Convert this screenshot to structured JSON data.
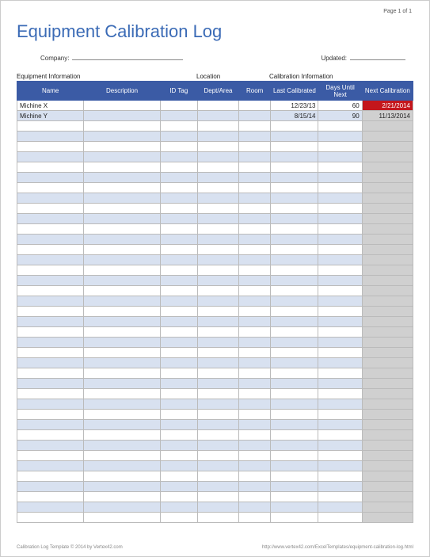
{
  "page_num": "Page 1 of 1",
  "title": "Equipment Calibration Log",
  "meta": {
    "company_label": "Company:",
    "company_value": "",
    "updated_label": "Updated:",
    "updated_value": ""
  },
  "sections": {
    "equipment": "Equipment Information",
    "location": "Location",
    "calibration": "Calibration Information"
  },
  "chart_data": {
    "type": "table",
    "headers": [
      "Name",
      "Description",
      "ID Tag",
      "Dept/Area",
      "Room",
      "Last Calibrated",
      "Days Until Next",
      "Next Calibration"
    ],
    "rows": [
      {
        "name": "Michine X",
        "description": "",
        "id_tag": "",
        "dept": "",
        "room": "",
        "last": "12/23/13",
        "days": "60",
        "next": "2/21/2014",
        "overdue": true
      },
      {
        "name": "Michine Y",
        "description": "",
        "id_tag": "",
        "dept": "",
        "room": "",
        "last": "8/15/14",
        "days": "90",
        "next": "11/13/2014",
        "overdue": false
      }
    ],
    "empty_rows": 39
  },
  "footer": {
    "left": "Calibration Log Template © 2014 by Vertex42.com",
    "right": "http://www.vertex42.com/ExcelTemplates/equipment-calibration-log.html"
  }
}
